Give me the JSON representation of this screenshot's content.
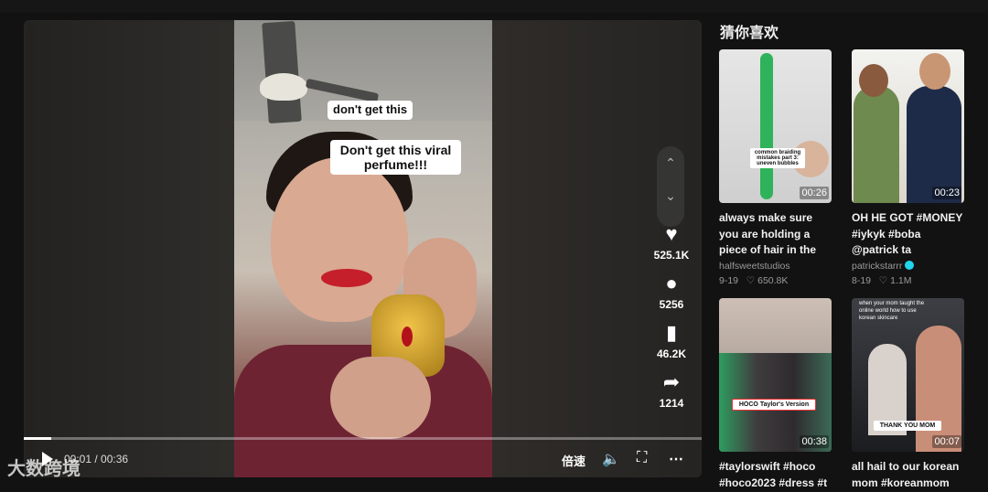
{
  "video": {
    "caption_top": "don't get this",
    "caption_main": "Don't get this viral perfume!!!",
    "time": "00:01 / 00:36",
    "progress": 0.04,
    "speed_label": "倍速"
  },
  "actions": {
    "likes": "525.1K",
    "comments": "5256",
    "saves": "46.2K",
    "shares": "1214"
  },
  "watermark": "大数跨境",
  "sidebar": {
    "title": "猜你喜欢",
    "cards": [
      {
        "duration": "00:26",
        "title": "always make sure you are holding a piece of hair in the center of...",
        "author": "halfsweetstudios",
        "date": "9-19",
        "likes": "650.8K",
        "thumb_text": "common braiding mistakes part 3: uneven bubbles"
      },
      {
        "duration": "00:23",
        "title": "OH HE GOT #MONEY #iykyk #boba @patrick ta",
        "author": "patrickstarrr",
        "date": "8-19",
        "likes": "1.1M"
      },
      {
        "duration": "00:38",
        "title": "#taylorswift #hoco #hoco2023 #dress #t",
        "thumb_text": "HOCO Taylor's Version"
      },
      {
        "duration": "00:07",
        "title": "all hail to our korean mom #koreanmom",
        "thumb_text_top": "when your mom taught the online world how to use korean skincare",
        "thumb_text": "THANK YOU MOM"
      }
    ]
  }
}
